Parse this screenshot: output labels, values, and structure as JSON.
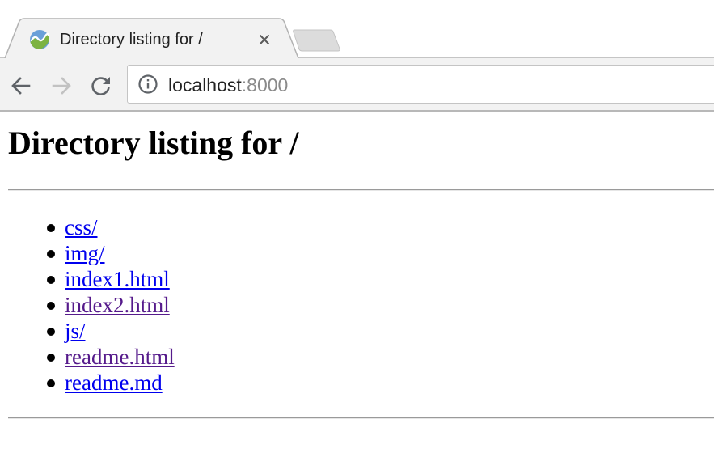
{
  "browser": {
    "tab": {
      "title": "Directory listing for /",
      "favicon": "chart-wave-favicon-icon",
      "close_icon": "close-icon"
    },
    "toolbar": {
      "back_icon": "arrow-left-icon",
      "forward_icon": "arrow-right-icon",
      "reload_icon": "reload-icon",
      "info_icon": "info-icon",
      "url_host": "localhost",
      "url_port": ":8000"
    }
  },
  "page": {
    "heading": "Directory listing for /",
    "files": [
      {
        "name": "css/",
        "visited": false
      },
      {
        "name": "img/",
        "visited": false
      },
      {
        "name": "index1.html",
        "visited": false
      },
      {
        "name": "index2.html",
        "visited": true
      },
      {
        "name": "js/",
        "visited": false
      },
      {
        "name": "readme.html",
        "visited": true
      },
      {
        "name": "readme.md",
        "visited": false
      }
    ]
  },
  "colors": {
    "link": "#0000ee",
    "visited_link": "#551a8b",
    "toolbar_bg": "#f2f2f2",
    "url_port": "#8a8a8a"
  }
}
